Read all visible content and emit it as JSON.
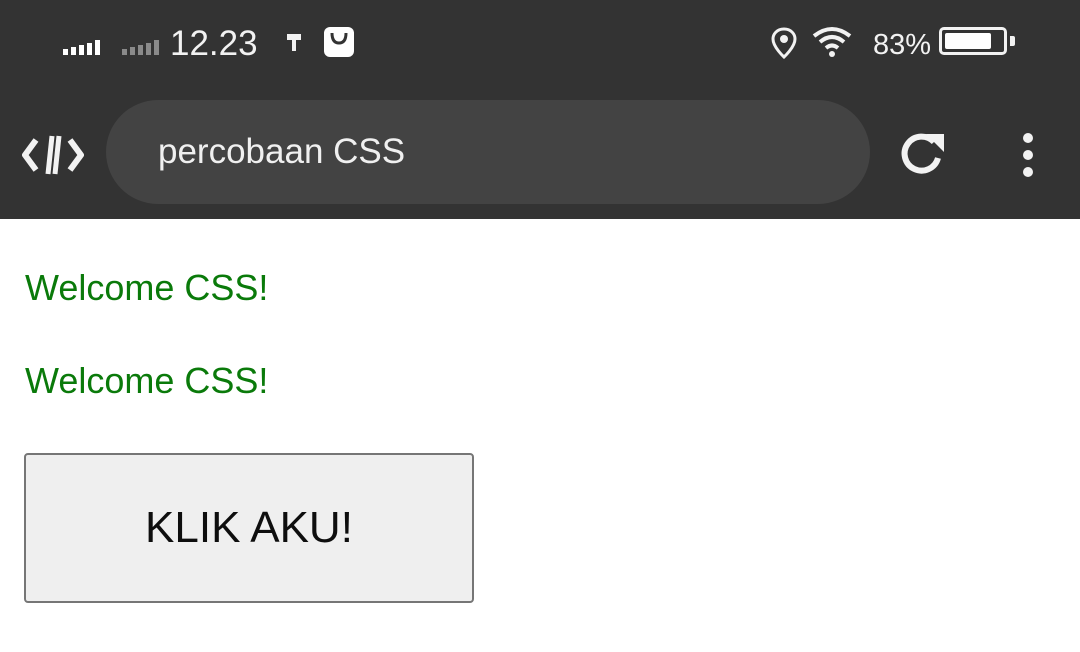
{
  "status_bar": {
    "time": "12.23",
    "battery_percent": "83%",
    "battery_level": 0.83,
    "icons": [
      "signal-icon",
      "signal-weak-icon",
      "usb-icon",
      "shopping-bag-icon",
      "location-icon",
      "wifi-icon",
      "battery-icon"
    ]
  },
  "browser": {
    "address_text": "percobaan CSS",
    "icons": [
      "code-editor-icon",
      "reload-icon",
      "more-vert-icon"
    ]
  },
  "page": {
    "heading_1": "Welcome CSS!",
    "heading_2": "Welcome CSS!",
    "button_label": "KLIK AKU!"
  },
  "colors": {
    "toolbar_bg": "#333333",
    "address_bg": "#434343",
    "welcome_text": "#0a7a0a",
    "button_bg": "#efefef",
    "button_border": "#767676"
  }
}
